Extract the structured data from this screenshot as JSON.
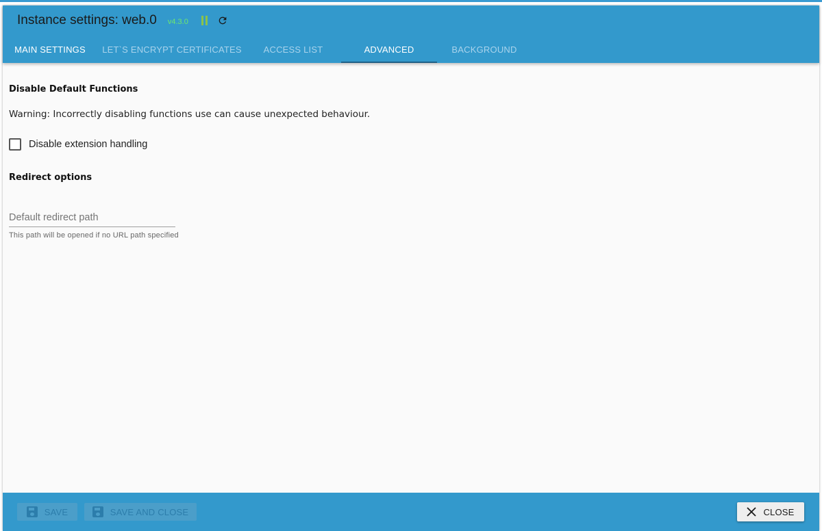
{
  "dialog": {
    "title": "Instance settings: web.0",
    "version": "v4.3.0",
    "icons": {
      "pause": "pause-icon",
      "reload": "reload-icon"
    },
    "colors": {
      "header_bg": "#3399cc",
      "version": "#6ee86e",
      "pause": "#8bc34a"
    }
  },
  "tabs": [
    {
      "label": "MAIN SETTINGS",
      "active": false
    },
    {
      "label": "LET`S ENCRYPT CERTIFICATES",
      "active": false
    },
    {
      "label": "ACCESS LIST",
      "active": false
    },
    {
      "label": "ADVANCED",
      "active": true
    },
    {
      "label": "BACKGROUND",
      "active": false
    }
  ],
  "advanced": {
    "disable_section_title": "Disable Default Functions",
    "warning": "Warning: Incorrectly disabling functions use can cause unexpected behaviour.",
    "disable_extension_label": "Disable extension handling",
    "disable_extension_checked": false,
    "redirect_section_title": "Redirect options",
    "redirect_field": {
      "placeholder": "Default redirect path",
      "value": "",
      "helper": "This path will be opened if no URL path specified"
    }
  },
  "footer": {
    "save_label": "SAVE",
    "save_close_label": "SAVE AND CLOSE",
    "close_label": "CLOSE",
    "save_icon": "floppy-disk-icon",
    "close_icon": "close-icon"
  }
}
